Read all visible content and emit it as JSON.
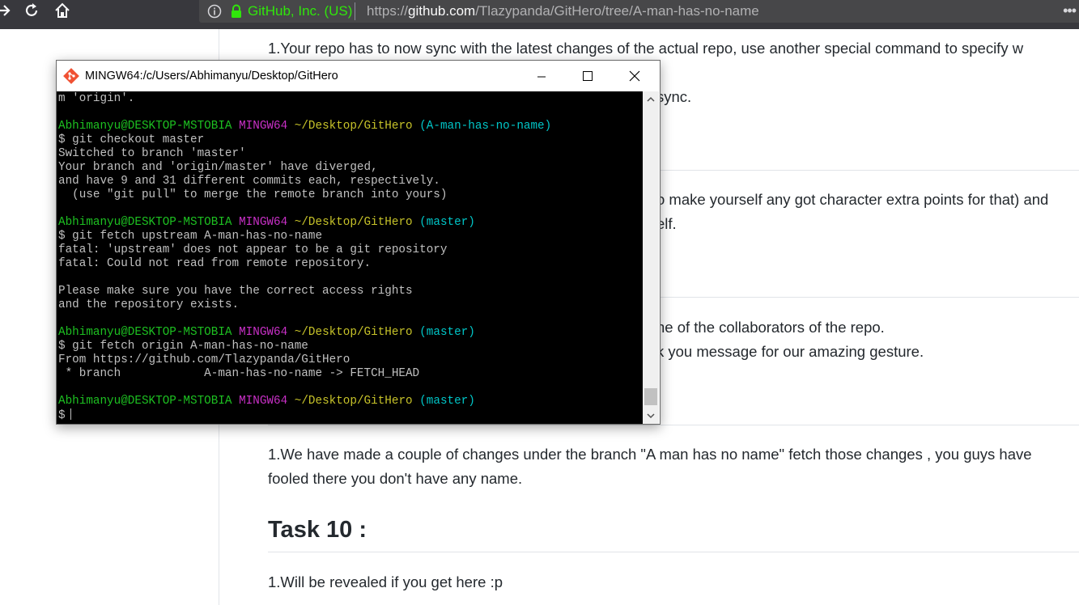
{
  "browser": {
    "org_label": "GitHub, Inc. (US)",
    "url_prefix": "https://",
    "url_domain": "github.com",
    "url_path": "/Tlazypanda/GitHero/tree/A-man-has-no-name",
    "menu_icon": "ellipsis-icon"
  },
  "page": {
    "paragraphs": [
      "1.Your repo has to now sync with the latest changes of the actual repo, use another special command to specify w",
      "sync.",
      "o make yourself any got character extra points for that) and",
      "elf.",
      "ne of the collaborators of the repo.",
      "k you message for our amazing gesture.",
      "1.We have made a couple of changes under the branch \"A man has no name\" fetch those changes , you guys have",
      "fooled there you don't have any name.",
      "1.Will be revealed if you get here :p"
    ],
    "task10_heading": "Task 10 :"
  },
  "terminal": {
    "title": "MINGW64:/c/Users/Abhimanyu/Desktop/GitHero",
    "lines": [
      [
        {
          "t": "m 'origin'.",
          "c": ""
        }
      ],
      [],
      [
        {
          "t": "Abhimanyu@DESKTOP-MSTOBIA",
          "c": "c-green"
        },
        {
          "t": " ",
          "c": ""
        },
        {
          "t": "MINGW64",
          "c": "c-mag"
        },
        {
          "t": " ",
          "c": ""
        },
        {
          "t": "~/Desktop/GitHero",
          "c": "c-yel"
        },
        {
          "t": " ",
          "c": ""
        },
        {
          "t": "(A-man-has-no-name)",
          "c": "c-cyan"
        }
      ],
      [
        {
          "t": "$ git checkout master",
          "c": ""
        }
      ],
      [
        {
          "t": "Switched to branch 'master'",
          "c": ""
        }
      ],
      [
        {
          "t": "Your branch and 'origin/master' have diverged,",
          "c": ""
        }
      ],
      [
        {
          "t": "and have 9 and 31 different commits each, respectively.",
          "c": ""
        }
      ],
      [
        {
          "t": "  (use \"git pull\" to merge the remote branch into yours)",
          "c": ""
        }
      ],
      [],
      [
        {
          "t": "Abhimanyu@DESKTOP-MSTOBIA",
          "c": "c-green"
        },
        {
          "t": " ",
          "c": ""
        },
        {
          "t": "MINGW64",
          "c": "c-mag"
        },
        {
          "t": " ",
          "c": ""
        },
        {
          "t": "~/Desktop/GitHero",
          "c": "c-yel"
        },
        {
          "t": " ",
          "c": ""
        },
        {
          "t": "(master)",
          "c": "c-cyan"
        }
      ],
      [
        {
          "t": "$ git fetch upstream A-man-has-no-name",
          "c": ""
        }
      ],
      [
        {
          "t": "fatal: 'upstream' does not appear to be a git repository",
          "c": ""
        }
      ],
      [
        {
          "t": "fatal: Could not read from remote repository.",
          "c": ""
        }
      ],
      [],
      [
        {
          "t": "Please make sure you have the correct access rights",
          "c": ""
        }
      ],
      [
        {
          "t": "and the repository exists.",
          "c": ""
        }
      ],
      [],
      [
        {
          "t": "Abhimanyu@DESKTOP-MSTOBIA",
          "c": "c-green"
        },
        {
          "t": " ",
          "c": ""
        },
        {
          "t": "MINGW64",
          "c": "c-mag"
        },
        {
          "t": " ",
          "c": ""
        },
        {
          "t": "~/Desktop/GitHero",
          "c": "c-yel"
        },
        {
          "t": " ",
          "c": ""
        },
        {
          "t": "(master)",
          "c": "c-cyan"
        }
      ],
      [
        {
          "t": "$ git fetch origin A-man-has-no-name",
          "c": ""
        }
      ],
      [
        {
          "t": "From https://github.com/Tlazypanda/GitHero",
          "c": ""
        }
      ],
      [
        {
          "t": " * branch            A-man-has-no-name -> FETCH_HEAD",
          "c": ""
        }
      ],
      [],
      [
        {
          "t": "Abhimanyu@DESKTOP-MSTOBIA",
          "c": "c-green"
        },
        {
          "t": " ",
          "c": ""
        },
        {
          "t": "MINGW64",
          "c": "c-mag"
        },
        {
          "t": " ",
          "c": ""
        },
        {
          "t": "~/Desktop/GitHero",
          "c": "c-yel"
        },
        {
          "t": " ",
          "c": ""
        },
        {
          "t": "(master)",
          "c": "c-cyan"
        }
      ],
      [
        {
          "t": "$",
          "c": ""
        }
      ]
    ]
  },
  "colors": {
    "terminal_bg": "#000000",
    "prompt_user": "#1dc121",
    "prompt_mingw": "#c930c7",
    "prompt_path": "#c7c329",
    "prompt_branch": "#00c5c7",
    "secure_green": "#30e60b"
  }
}
